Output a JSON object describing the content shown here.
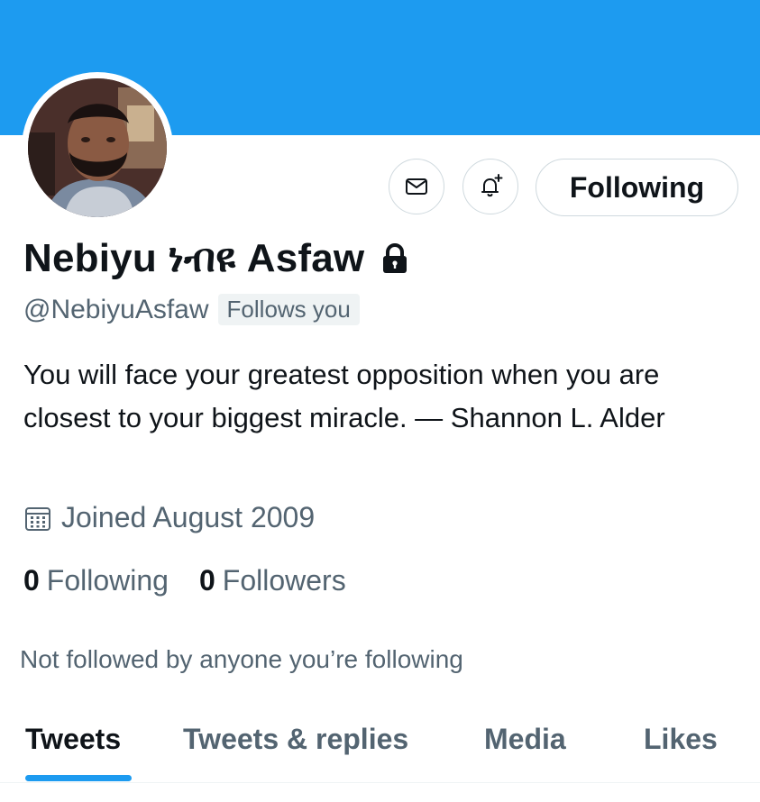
{
  "header": {
    "banner_color": "#1d9bf0"
  },
  "profile": {
    "display_name": "Nebiyu ነብዩ Asfaw",
    "handle": "@NebiyuAsfaw",
    "follows_you_label": "Follows you",
    "protected": true,
    "bio": "You will face your greatest opposition when you are closest to your biggest miracle.  — Shannon L. Alder",
    "joined": "Joined August 2009",
    "following_count": "0",
    "following_label": "Following",
    "followers_count": "0",
    "followers_label": "Followers",
    "not_followed_text": "Not followed by anyone you’re following"
  },
  "actions": {
    "message_icon": "envelope-icon",
    "notify_icon": "bell-plus-icon",
    "follow_button_label": "Following"
  },
  "tabs": [
    {
      "label": "Tweets",
      "active": true
    },
    {
      "label": "Tweets & replies",
      "active": false
    },
    {
      "label": "Media",
      "active": false
    },
    {
      "label": "Likes",
      "active": false
    }
  ],
  "colors": {
    "accent": "#1d9bf0",
    "text_primary": "#0f1419",
    "text_secondary": "#536471"
  }
}
